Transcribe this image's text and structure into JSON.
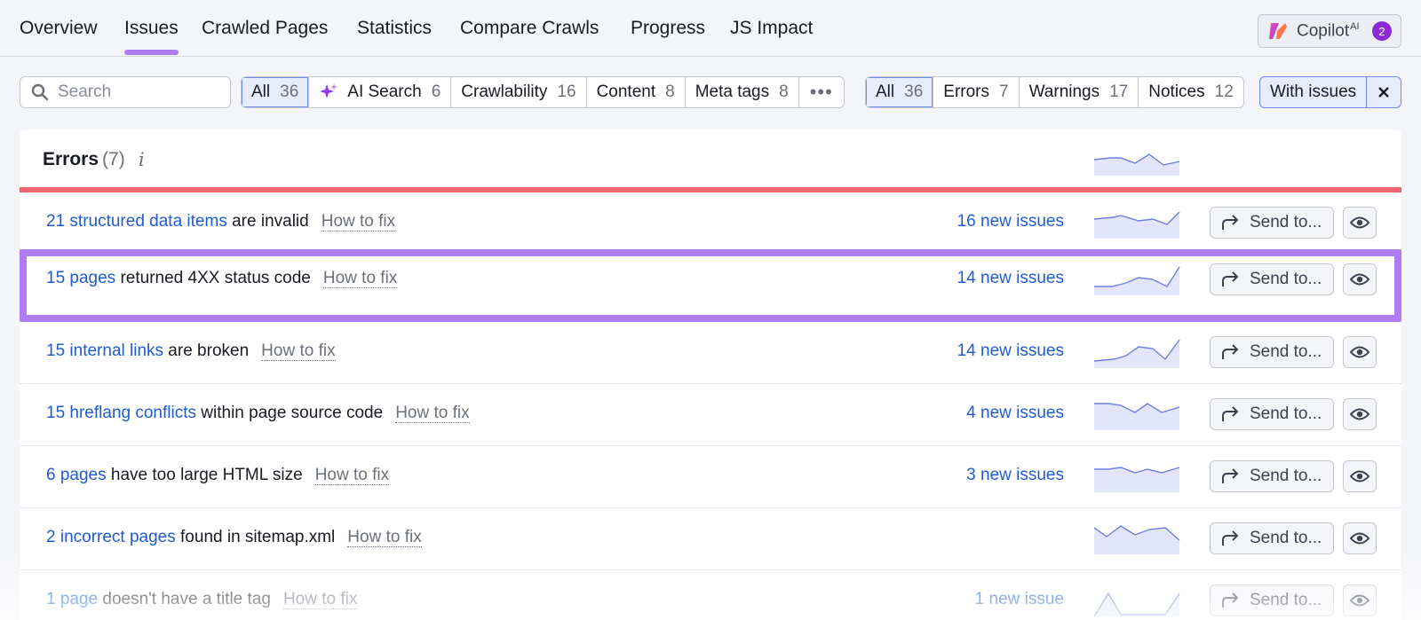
{
  "nav": {
    "tabs": [
      {
        "label": "Overview"
      },
      {
        "label": "Issues"
      },
      {
        "label": "Crawled Pages"
      },
      {
        "label": "Statistics"
      },
      {
        "label": "Compare Crawls"
      },
      {
        "label": "Progress"
      },
      {
        "label": "JS Impact"
      }
    ],
    "active_tab": "Issues",
    "copilot": {
      "label": "Copilot",
      "sup": "AI",
      "badge": "2"
    }
  },
  "filters": {
    "search_placeholder": "Search",
    "categories": [
      {
        "label": "All",
        "count": "36"
      },
      {
        "label": "AI Search",
        "count": "6"
      },
      {
        "label": "Crawlability",
        "count": "16"
      },
      {
        "label": "Content",
        "count": "8"
      },
      {
        "label": "Meta tags",
        "count": "8"
      }
    ],
    "more_label": "•••",
    "severity": [
      {
        "label": "All",
        "count": "36"
      },
      {
        "label": "Errors",
        "count": "7"
      },
      {
        "label": "Warnings",
        "count": "17"
      },
      {
        "label": "Notices",
        "count": "12"
      }
    ],
    "chip_label": "With issues"
  },
  "errors": {
    "title": "Errors",
    "count": "(7)",
    "info": "i",
    "send_label": "Send to...",
    "how_to_fix": "How to fix",
    "rows": [
      {
        "link": "21 structured data items",
        "text": " are invalid",
        "new": "16 new issues"
      },
      {
        "link": "15 pages",
        "text": " returned 4XX status code",
        "new": "14 new issues"
      },
      {
        "link": "15 internal links",
        "text": " are broken",
        "new": "14 new issues"
      },
      {
        "link": "15 hreflang conflicts",
        "text": " within page source code",
        "new": "4 new issues"
      },
      {
        "link": "6 pages",
        "text": " have too large HTML size",
        "new": "3 new issues"
      },
      {
        "link": "2 incorrect pages",
        "text": " found in sitemap.xml",
        "new": ""
      },
      {
        "link": "1 page",
        "text": " doesn't have a title tag",
        "new": "1 new issue"
      }
    ]
  },
  "colors": {
    "accent_purple": "#b07cf3",
    "link_blue": "#1f5bd6",
    "error_red": "#f0656f",
    "sparkline_fill": "#e3e5fb",
    "sparkline_line": "#6f7ee0"
  }
}
